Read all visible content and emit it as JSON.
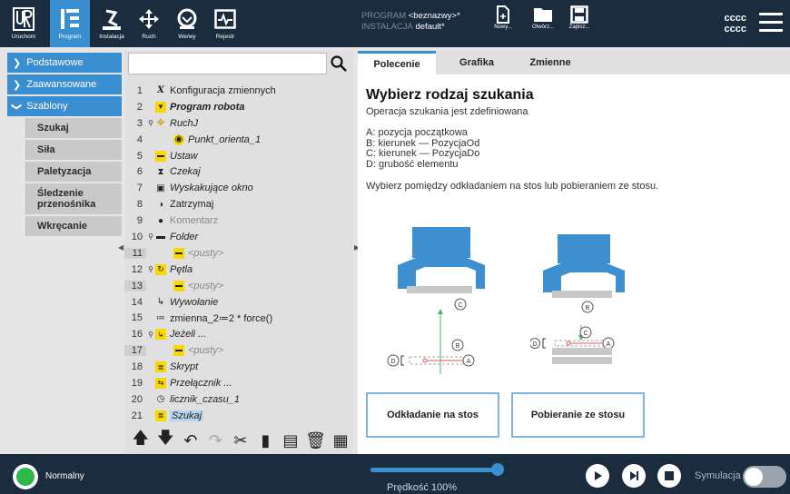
{
  "nav": [
    {
      "label": "Uruchom",
      "icon": "ur-logo-icon"
    },
    {
      "label": "Program",
      "icon": "program-icon"
    },
    {
      "label": "Instalacja",
      "icon": "robot-arm-icon"
    },
    {
      "label": "Ruch",
      "icon": "move-arrows-icon"
    },
    {
      "label": "We/wy",
      "icon": "io-icon"
    },
    {
      "label": "Rejestr",
      "icon": "log-icon"
    }
  ],
  "header": {
    "program_key": "PROGRAM",
    "program_value": "<beznazwy>*",
    "install_key": "INSTALACJA",
    "install_value": "default*",
    "new_label": "Nowy...",
    "open_label": "Otwórz...",
    "save_label": "Zapisz...",
    "user_line1": "cccc",
    "user_line2": "cccc"
  },
  "sidebar": {
    "basic": "Podstawowe",
    "advanced": "Zaawansowane",
    "templates": "Szablony",
    "template_items": [
      "Szukaj",
      "Siła",
      "Paletyzacja",
      "Śledzenie przenośnika",
      "Wkręcanie"
    ]
  },
  "tree": {
    "rows": [
      {
        "num": "1",
        "text": "Konfiguracja zmiennych"
      },
      {
        "num": "2",
        "text": "Program robota"
      },
      {
        "num": "3",
        "text": "RuchJ"
      },
      {
        "num": "4",
        "text": "Punkt_orienta_1"
      },
      {
        "num": "5",
        "text": "Ustaw"
      },
      {
        "num": "6",
        "text": "Czekaj"
      },
      {
        "num": "7",
        "text": "Wyskakujące okno"
      },
      {
        "num": "8",
        "text": "Zatrzymaj"
      },
      {
        "num": "9",
        "text": "Komentarz"
      },
      {
        "num": "10",
        "text": "Folder"
      },
      {
        "num": "11",
        "text": "<pusty>"
      },
      {
        "num": "12",
        "text": "Pętla"
      },
      {
        "num": "13",
        "text": "<pusty>"
      },
      {
        "num": "14",
        "text": "Wywołanie"
      },
      {
        "num": "15",
        "text": "zmienna_2≔2 * force()"
      },
      {
        "num": "16",
        "text": "Jeżeli ..."
      },
      {
        "num": "17",
        "text": "<pusty>"
      },
      {
        "num": "18",
        "text": "Skrypt"
      },
      {
        "num": "19",
        "text": "Przełącznik ..."
      },
      {
        "num": "20",
        "text": "licznik_czasu_1"
      },
      {
        "num": "21",
        "text": "Szukaj"
      }
    ]
  },
  "tabs": [
    "Polecenie",
    "Grafika",
    "Zmienne"
  ],
  "command": {
    "title": "Wybierz rodzaj szukania",
    "subtitle": "Operacja szukania jest zdefiniowana",
    "list": [
      "A: pozycja początkowa",
      "B: kierunek — PozycjaOd",
      "C: kierunek — PozycjaDo",
      "D: grubość elementu"
    ],
    "note": "Wybierz pomiędzy odkładaniem na stos lub pobieraniem ze stosu.",
    "stack_button": "Odkładanie na stos",
    "destack_button": "Pobieranie ze stosu",
    "diagram_letters": {
      "a": "A",
      "b": "B",
      "c": "C",
      "d": "D"
    }
  },
  "footer": {
    "status": "Normalny",
    "speed_label": "Prędkość 100%",
    "speed_fraction": 1.0,
    "sim_label": "Symulacja"
  },
  "colors": {
    "topbar": "#1b2c3f",
    "accent": "#3a8fd0",
    "status_ok": "#2eb84b",
    "node_yellow": "#f7d900"
  }
}
